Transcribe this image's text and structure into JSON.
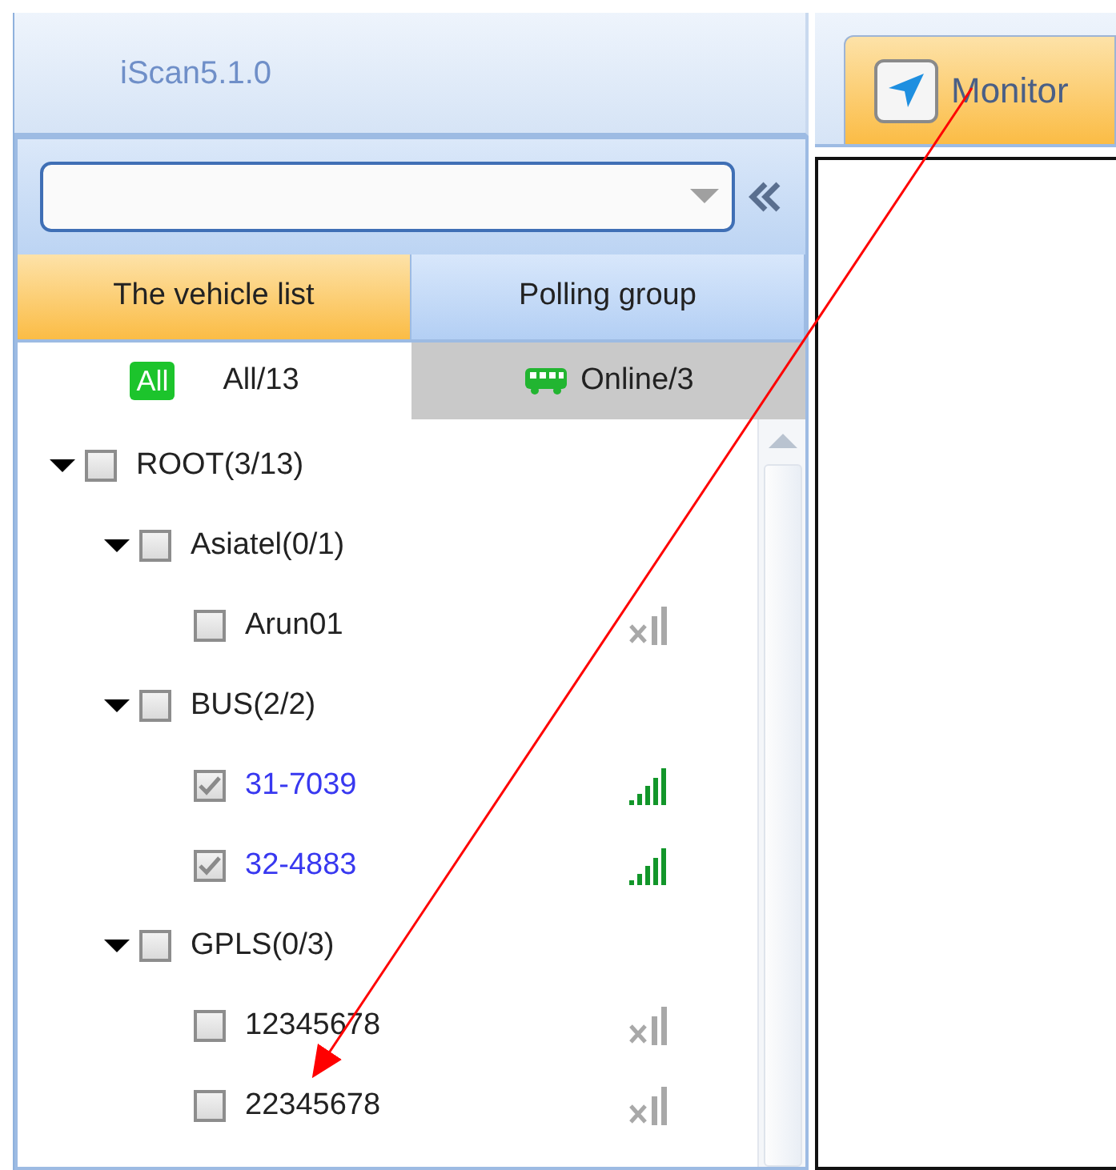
{
  "app": {
    "title": "iScan5.1.0"
  },
  "main_tabs": [
    {
      "label": "Monitor",
      "selected": true
    }
  ],
  "panel_tabs": [
    {
      "label": "The vehicle list",
      "selected": true
    },
    {
      "label": "Polling group",
      "selected": false
    }
  ],
  "filter_tabs": [
    {
      "kind": "all",
      "badge": "All",
      "label": "All/13",
      "selected": true
    },
    {
      "kind": "online",
      "label": "Online/3",
      "selected": false
    }
  ],
  "tree": [
    {
      "kind": "group",
      "label": "ROOT(3/13)",
      "expanded": true,
      "checked": false,
      "children": [
        {
          "kind": "group",
          "label": "Asiatel(0/1)",
          "expanded": true,
          "checked": false,
          "children": [
            {
              "kind": "vehicle",
              "label": "Arun01",
              "checked": false,
              "online": false
            }
          ]
        },
        {
          "kind": "group",
          "label": "BUS(2/2)",
          "expanded": true,
          "checked": false,
          "children": [
            {
              "kind": "vehicle",
              "label": "31-7039",
              "checked": true,
              "online": true
            },
            {
              "kind": "vehicle",
              "label": "32-4883",
              "checked": true,
              "online": true
            }
          ]
        },
        {
          "kind": "group",
          "label": "GPLS(0/3)",
          "expanded": true,
          "checked": false,
          "children": [
            {
              "kind": "vehicle",
              "label": "12345678",
              "checked": false,
              "online": false
            },
            {
              "kind": "vehicle",
              "label": "22345678",
              "checked": false,
              "online": false
            }
          ]
        }
      ]
    }
  ],
  "annotation": {
    "kind": "arrow"
  }
}
